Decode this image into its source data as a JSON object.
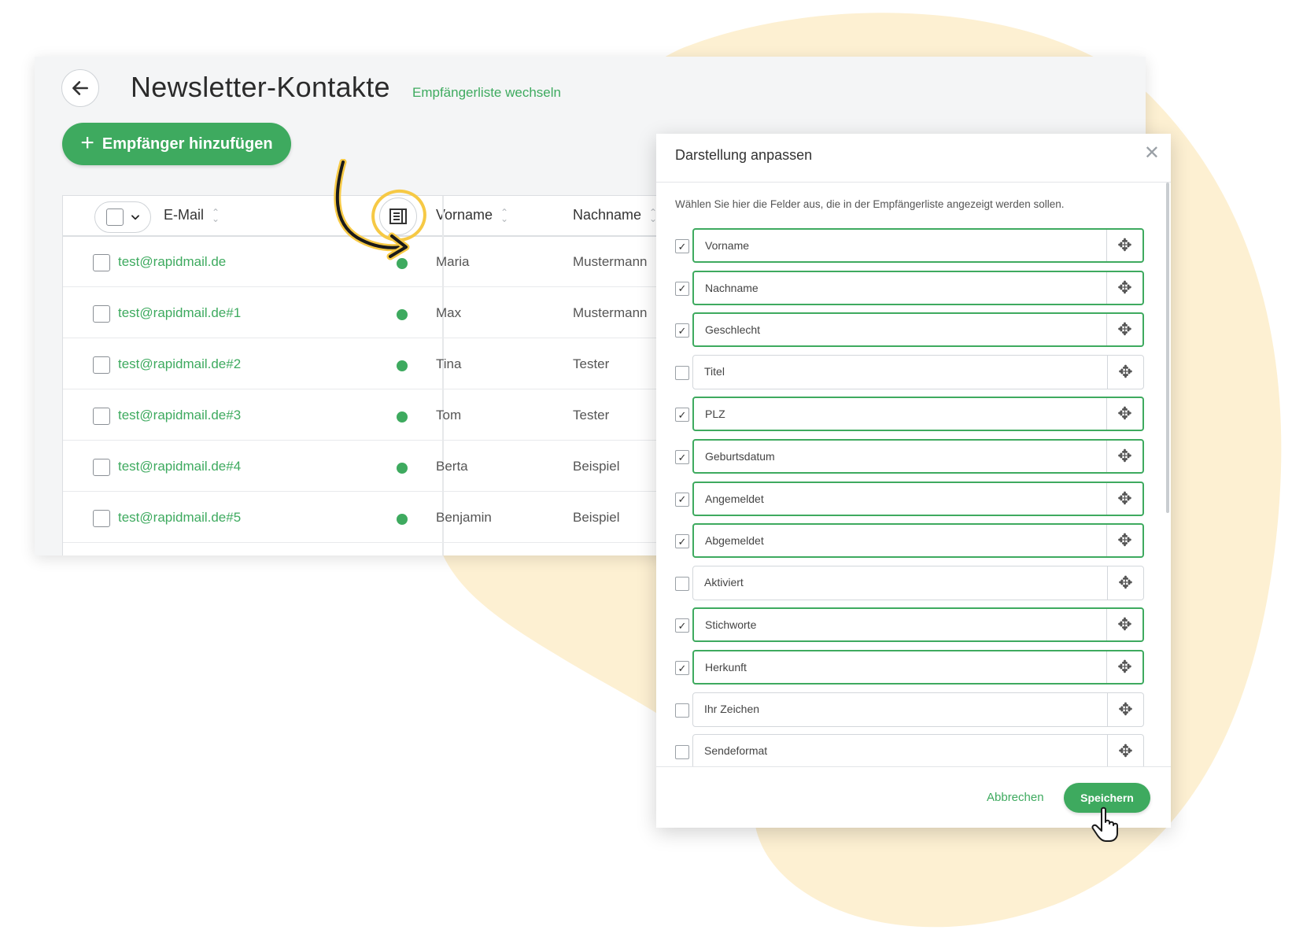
{
  "header": {
    "title": "Newsletter-Kontakte",
    "switch_link": "Empfängerliste wechseln",
    "add_button": "Empfänger hinzufügen"
  },
  "table": {
    "columns": [
      "E-Mail",
      "Vorname",
      "Nachname"
    ],
    "rows": [
      {
        "email": "test@rapidmail.de",
        "first": "Maria",
        "last": "Mustermann"
      },
      {
        "email": "test@rapidmail.de#1",
        "first": "Max",
        "last": "Mustermann"
      },
      {
        "email": "test@rapidmail.de#2",
        "first": "Tina",
        "last": "Tester"
      },
      {
        "email": "test@rapidmail.de#3",
        "first": "Tom",
        "last": "Tester"
      },
      {
        "email": "test@rapidmail.de#4",
        "first": "Berta",
        "last": "Beispiel"
      },
      {
        "email": "test@rapidmail.de#5",
        "first": "Benjamin",
        "last": "Beispiel"
      }
    ]
  },
  "dialog": {
    "title": "Darstellung anpassen",
    "description": "Wählen Sie hier die Felder aus, die in der Empfängerliste angezeigt werden sollen.",
    "fields": [
      {
        "label": "Vorname",
        "checked": true
      },
      {
        "label": "Nachname",
        "checked": true
      },
      {
        "label": "Geschlecht",
        "checked": true
      },
      {
        "label": "Titel",
        "checked": false
      },
      {
        "label": "PLZ",
        "checked": true
      },
      {
        "label": "Geburtsdatum",
        "checked": true
      },
      {
        "label": "Angemeldet",
        "checked": true
      },
      {
        "label": "Abgemeldet",
        "checked": true
      },
      {
        "label": "Aktiviert",
        "checked": false
      },
      {
        "label": "Stichworte",
        "checked": true
      },
      {
        "label": "Herkunft",
        "checked": true
      },
      {
        "label": "Ihr Zeichen",
        "checked": false
      },
      {
        "label": "Sendeformat",
        "checked": false
      }
    ],
    "cancel": "Abbrechen",
    "save": "Speichern"
  },
  "colors": {
    "accent": "#3eaa5f",
    "highlight": "#f6c945",
    "blob": "#fdf0d2"
  },
  "icons": [
    "arrow-left-icon",
    "plus-icon",
    "sort-icon",
    "column-view-icon",
    "close-icon",
    "drag-move-icon",
    "pointer-hand-icon",
    "check-icon"
  ]
}
